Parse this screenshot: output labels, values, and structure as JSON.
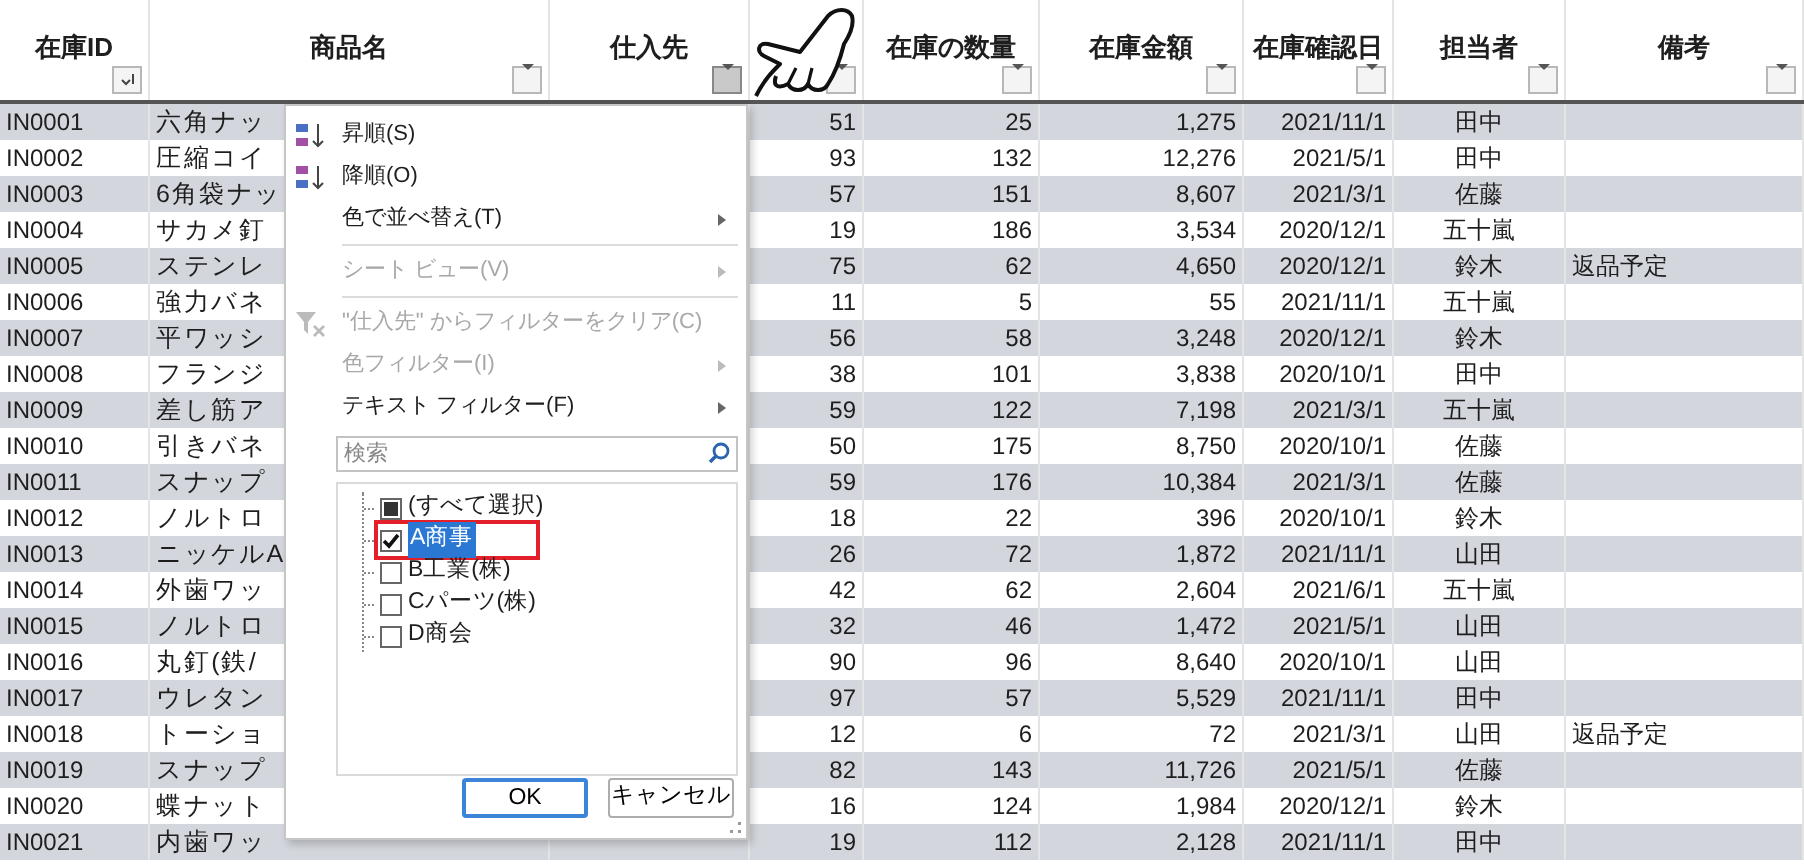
{
  "columns": [
    {
      "label": "在庫ID",
      "kind": "sorted",
      "open": false
    },
    {
      "label": "商品名",
      "kind": "filter",
      "open": false
    },
    {
      "label": "仕入先",
      "kind": "filter",
      "open": true
    },
    {
      "kind": "filter",
      "open": false
    },
    {
      "label": "在庫の数量",
      "kind": "filter",
      "open": false
    },
    {
      "label": "在庫金額",
      "kind": "filter",
      "open": false
    },
    {
      "label": "在庫確認日",
      "kind": "filter",
      "open": false
    },
    {
      "label": "担当者",
      "kind": "filter",
      "open": false
    },
    {
      "label": "備考",
      "kind": "filter",
      "open": false
    }
  ],
  "rows": [
    {
      "id": "IN0001",
      "product": "六角ナッ",
      "column_4": "51",
      "quantity": "25",
      "amount": "1,275",
      "date": "2021/11/1",
      "person": "田中"
    },
    {
      "id": "IN0002",
      "product": "圧縮コイ",
      "column_4": "93",
      "quantity": "132",
      "amount": "12,276",
      "date": "2021/5/1",
      "person": "田中"
    },
    {
      "id": "IN0003",
      "product": "6角袋ナッ",
      "column_4": "57",
      "quantity": "151",
      "amount": "8,607",
      "date": "2021/3/1",
      "person": "佐藤"
    },
    {
      "id": "IN0004",
      "product": "サカメ釘",
      "column_4": "19",
      "quantity": "186",
      "amount": "3,534",
      "date": "2020/12/1",
      "person": "五十嵐"
    },
    {
      "id": "IN0005",
      "product": "ステンレ",
      "column_4": "75",
      "quantity": "62",
      "amount": "4,650",
      "date": "2020/12/1",
      "person": "鈴木",
      "note": "返品予定"
    },
    {
      "id": "IN0006",
      "product": "強力バネ",
      "column_4": "11",
      "quantity": "5",
      "amount": "55",
      "date": "2021/11/1",
      "person": "五十嵐"
    },
    {
      "id": "IN0007",
      "product": "平ワッシ",
      "column_4": "56",
      "quantity": "58",
      "amount": "3,248",
      "date": "2020/12/1",
      "person": "鈴木"
    },
    {
      "id": "IN0008",
      "product": "フランジ",
      "column_4": "38",
      "quantity": "101",
      "amount": "3,838",
      "date": "2020/10/1",
      "person": "田中"
    },
    {
      "id": "IN0009",
      "product": "差し筋ア",
      "column_4": "59",
      "quantity": "122",
      "amount": "7,198",
      "date": "2021/3/1",
      "person": "五十嵐"
    },
    {
      "id": "IN0010",
      "product": "引きバネ",
      "column_4": "50",
      "quantity": "175",
      "amount": "8,750",
      "date": "2020/10/1",
      "person": "佐藤"
    },
    {
      "id": "IN0011",
      "product": "スナップ",
      "column_4": "59",
      "quantity": "176",
      "amount": "10,384",
      "date": "2021/3/1",
      "person": "佐藤"
    },
    {
      "id": "IN0012",
      "product": "ノルトロ",
      "column_4": "18",
      "quantity": "22",
      "amount": "396",
      "date": "2020/10/1",
      "person": "鈴木"
    },
    {
      "id": "IN0013",
      "product": "ニッケルA",
      "column_4": "26",
      "quantity": "72",
      "amount": "1,872",
      "date": "2021/11/1",
      "person": "山田"
    },
    {
      "id": "IN0014",
      "product": "外歯ワッ",
      "column_4": "42",
      "quantity": "62",
      "amount": "2,604",
      "date": "2021/6/1",
      "person": "五十嵐"
    },
    {
      "id": "IN0015",
      "product": "ノルトロ",
      "column_4": "32",
      "quantity": "46",
      "amount": "1,472",
      "date": "2021/5/1",
      "person": "山田"
    },
    {
      "id": "IN0016",
      "product": "丸釘(鉄/",
      "column_4": "90",
      "quantity": "96",
      "amount": "8,640",
      "date": "2020/10/1",
      "person": "山田"
    },
    {
      "id": "IN0017",
      "product": "ウレタン",
      "column_4": "97",
      "quantity": "57",
      "amount": "5,529",
      "date": "2021/11/1",
      "person": "田中"
    },
    {
      "id": "IN0018",
      "product": "トーショ",
      "column_4": "12",
      "quantity": "6",
      "amount": "72",
      "date": "2021/3/1",
      "person": "山田",
      "note": "返品予定"
    },
    {
      "id": "IN0019",
      "product": "スナップ",
      "column_4": "82",
      "quantity": "143",
      "amount": "11,726",
      "date": "2021/5/1",
      "person": "佐藤"
    },
    {
      "id": "IN0020",
      "product": "蝶ナット",
      "column_4": "16",
      "quantity": "124",
      "amount": "1,984",
      "date": "2020/12/1",
      "person": "鈴木"
    },
    {
      "id": "IN0021",
      "product": "内歯ワッ",
      "column_4": "19",
      "quantity": "112",
      "amount": "2,128",
      "date": "2021/11/1",
      "person": "田中"
    }
  ],
  "filter_menu": {
    "items": [
      {
        "label": "昇順(S)",
        "kind": "sort-asc",
        "disabled": false,
        "submenu": false
      },
      {
        "label": "降順(O)",
        "kind": "sort-desc",
        "disabled": false,
        "submenu": false
      },
      {
        "label": "色で並べ替え(T)",
        "kind": "plain",
        "disabled": false,
        "submenu": true,
        "separator_after": true
      },
      {
        "label": "シート ビュー(V)",
        "kind": "plain",
        "disabled": true,
        "submenu": true,
        "separator_after": true
      },
      {
        "label": "\"仕入先\" からフィルターをクリア(C)",
        "kind": "clear-filter",
        "disabled": true,
        "submenu": false
      },
      {
        "label": "色フィルター(I)",
        "kind": "plain",
        "disabled": true,
        "submenu": true
      },
      {
        "label": "テキスト フィルター(F)",
        "kind": "plain",
        "disabled": false,
        "submenu": true
      }
    ],
    "search": {
      "placeholder": "検索"
    },
    "values": [
      {
        "label": "(すべて選択)",
        "checked": false,
        "indeterminate": true,
        "selected": false,
        "highlighted": false
      },
      {
        "label": "A商事",
        "checked": true,
        "selected": true,
        "highlighted": true
      },
      {
        "label": "B工業(株)",
        "checked": false,
        "selected": false,
        "highlighted": false
      },
      {
        "label": "Cパーツ(株)",
        "checked": false,
        "selected": false,
        "highlighted": false
      },
      {
        "label": "D商会",
        "checked": false,
        "selected": false,
        "highlighted": false
      }
    ],
    "buttons": [
      {
        "label": "OK",
        "default": true
      },
      {
        "label": "キャンセル",
        "default": false
      }
    ]
  }
}
